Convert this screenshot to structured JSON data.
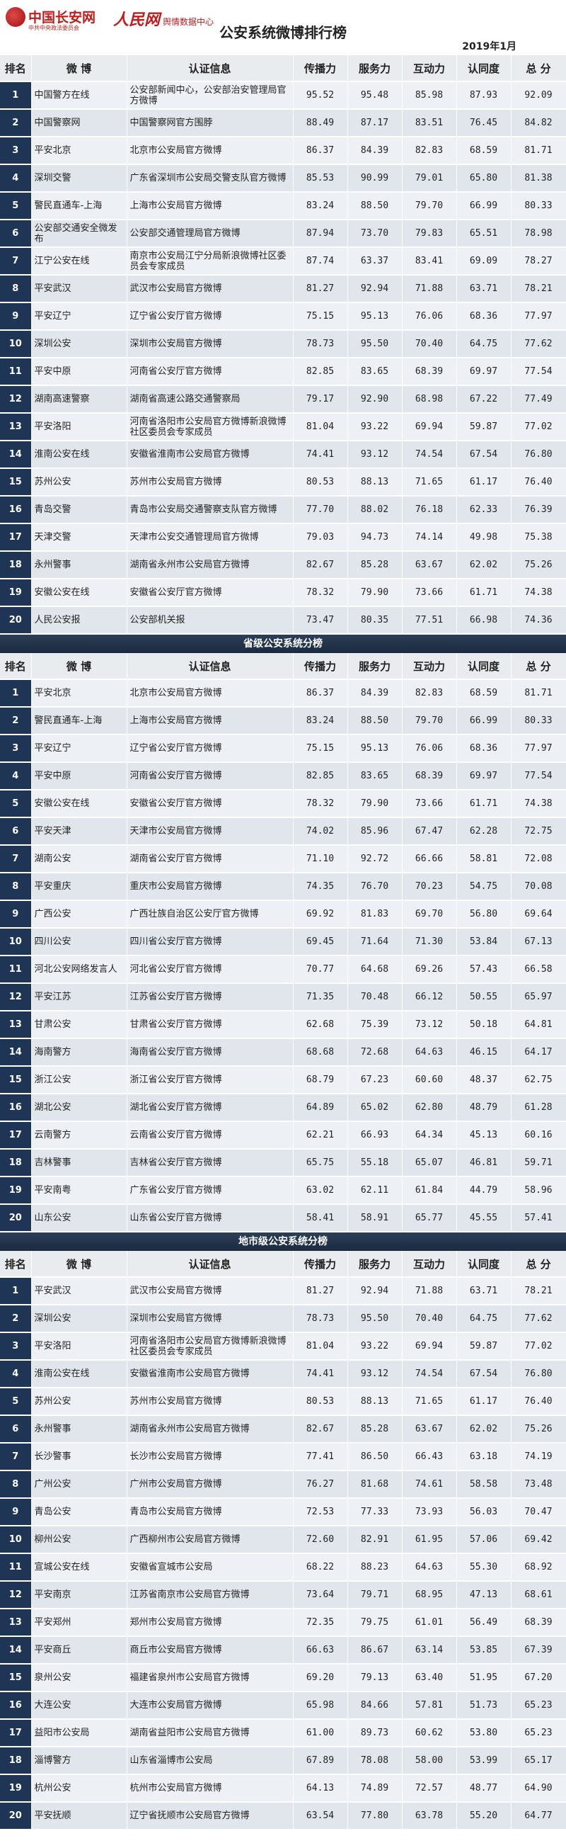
{
  "header": {
    "logo1_title": "中国长安网",
    "logo1_sub": "中共中央政法委员会",
    "logo2_title": "人民网",
    "logo2_sub": "舆情数据中心",
    "title": "公安系统微博排行榜",
    "date": "2019年1月"
  },
  "columns": [
    "排名",
    "微 博",
    "认证信息",
    "传播力",
    "服务力",
    "互动力",
    "认同度",
    "总 分"
  ],
  "sections": [
    {
      "title": "",
      "rows": [
        [
          "1",
          "中国警方在线",
          "公安部新闻中心，公安部治安管理局官方微博",
          "95.52",
          "95.48",
          "85.98",
          "87.93",
          "92.09"
        ],
        [
          "2",
          "中国警察网",
          "中国警察网官方围脖",
          "88.49",
          "87.17",
          "83.51",
          "76.45",
          "84.82"
        ],
        [
          "3",
          "平安北京",
          "北京市公安局官方微博",
          "86.37",
          "84.39",
          "82.83",
          "68.59",
          "81.71"
        ],
        [
          "4",
          "深圳交警",
          "广东省深圳市公安局交警支队官方微博",
          "85.53",
          "90.99",
          "79.01",
          "65.80",
          "81.38"
        ],
        [
          "5",
          "警民直通车-上海",
          "上海市公安局官方微博",
          "83.24",
          "88.50",
          "79.70",
          "66.99",
          "80.33"
        ],
        [
          "6",
          "公安部交通安全微发布",
          "公安部交通管理局官方微博",
          "87.94",
          "73.70",
          "79.83",
          "65.51",
          "78.98"
        ],
        [
          "7",
          "江宁公安在线",
          "南京市公安局江宁分局新浪微博社区委员会专家成员",
          "87.74",
          "63.37",
          "83.41",
          "69.09",
          "78.27"
        ],
        [
          "8",
          "平安武汉",
          "武汉市公安局官方微博",
          "81.27",
          "92.94",
          "71.88",
          "63.71",
          "78.21"
        ],
        [
          "9",
          "平安辽宁",
          "辽宁省公安厅官方微博",
          "75.15",
          "95.13",
          "76.06",
          "68.36",
          "77.97"
        ],
        [
          "10",
          "深圳公安",
          "深圳市公安局官方微博",
          "78.73",
          "95.50",
          "70.40",
          "64.75",
          "77.62"
        ],
        [
          "11",
          "平安中原",
          "河南省公安厅官方微博",
          "82.85",
          "83.65",
          "68.39",
          "69.97",
          "77.54"
        ],
        [
          "12",
          "湖南高速警察",
          "湖南省高速公路交通警察局",
          "79.17",
          "92.90",
          "68.98",
          "67.22",
          "77.49"
        ],
        [
          "13",
          "平安洛阳",
          "河南省洛阳市公安局官方微博新浪微博社区委员会专家成员",
          "81.04",
          "93.22",
          "69.94",
          "59.87",
          "77.02"
        ],
        [
          "14",
          "淮南公安在线",
          "安徽省淮南市公安局官方微博",
          "74.41",
          "93.12",
          "74.54",
          "67.54",
          "76.80"
        ],
        [
          "15",
          "苏州公安",
          "苏州市公安局官方微博",
          "80.53",
          "88.13",
          "71.65",
          "61.17",
          "76.40"
        ],
        [
          "16",
          "青岛交警",
          "青岛市公安局交通警察支队官方微博",
          "77.70",
          "88.02",
          "76.18",
          "62.33",
          "76.39"
        ],
        [
          "17",
          "天津交警",
          "天津市公安交通管理局官方微博",
          "79.03",
          "94.73",
          "74.14",
          "49.98",
          "75.38"
        ],
        [
          "18",
          "永州警事",
          "湖南省永州市公安局官方微博",
          "82.67",
          "85.28",
          "63.67",
          "62.02",
          "75.26"
        ],
        [
          "19",
          "安徽公安在线",
          "安徽省公安厅官方微博",
          "78.32",
          "79.90",
          "73.66",
          "61.71",
          "74.38"
        ],
        [
          "20",
          "人民公安报",
          "公安部机关报",
          "73.47",
          "80.35",
          "77.51",
          "66.98",
          "74.36"
        ]
      ]
    },
    {
      "title": "省级公安系统分榜",
      "rows": [
        [
          "1",
          "平安北京",
          "北京市公安局官方微博",
          "86.37",
          "84.39",
          "82.83",
          "68.59",
          "81.71"
        ],
        [
          "2",
          "警民直通车-上海",
          "上海市公安局官方微博",
          "83.24",
          "88.50",
          "79.70",
          "66.99",
          "80.33"
        ],
        [
          "3",
          "平安辽宁",
          "辽宁省公安厅官方微博",
          "75.15",
          "95.13",
          "76.06",
          "68.36",
          "77.97"
        ],
        [
          "4",
          "平安中原",
          "河南省公安厅官方微博",
          "82.85",
          "83.65",
          "68.39",
          "69.97",
          "77.54"
        ],
        [
          "5",
          "安徽公安在线",
          "安徽省公安厅官方微博",
          "78.32",
          "79.90",
          "73.66",
          "61.71",
          "74.38"
        ],
        [
          "6",
          "平安天津",
          "天津市公安局官方微博",
          "74.02",
          "85.96",
          "67.47",
          "62.28",
          "72.75"
        ],
        [
          "7",
          "湖南公安",
          "湖南省公安厅官方微博",
          "71.10",
          "92.72",
          "66.66",
          "58.81",
          "72.08"
        ],
        [
          "8",
          "平安重庆",
          "重庆市公安局官方微博",
          "74.35",
          "76.70",
          "70.23",
          "54.75",
          "70.08"
        ],
        [
          "9",
          "广西公安",
          "广西壮族自治区公安厅官方微博",
          "69.92",
          "81.83",
          "69.70",
          "56.80",
          "69.64"
        ],
        [
          "10",
          "四川公安",
          "四川省公安厅官方微博",
          "69.45",
          "71.64",
          "71.30",
          "53.84",
          "67.13"
        ],
        [
          "11",
          "河北公安网络发言人",
          "河北省公安厅官方微博",
          "70.77",
          "64.68",
          "69.26",
          "57.43",
          "66.58"
        ],
        [
          "12",
          "平安江苏",
          "江苏省公安厅官方微博",
          "71.35",
          "70.48",
          "66.12",
          "50.55",
          "65.97"
        ],
        [
          "13",
          "甘肃公安",
          "甘肃省公安厅官方微博",
          "62.68",
          "75.39",
          "73.12",
          "50.18",
          "64.81"
        ],
        [
          "14",
          "海南警方",
          "海南省公安厅官方微博",
          "68.68",
          "72.68",
          "64.63",
          "46.15",
          "64.17"
        ],
        [
          "15",
          "浙江公安",
          "浙江省公安厅官方微博",
          "68.79",
          "67.23",
          "60.60",
          "48.37",
          "62.75"
        ],
        [
          "16",
          "湖北公安",
          "湖北省公安厅官方微博",
          "64.89",
          "65.02",
          "62.80",
          "48.79",
          "61.28"
        ],
        [
          "17",
          "云南警方",
          "云南省公安厅官方微博",
          "62.21",
          "66.93",
          "64.34",
          "45.13",
          "60.16"
        ],
        [
          "18",
          "吉林警事",
          "吉林省公安厅官方微博",
          "65.75",
          "55.18",
          "65.07",
          "46.81",
          "59.71"
        ],
        [
          "19",
          "平安南粤",
          "广东省公安厅官方微博",
          "63.02",
          "62.11",
          "61.84",
          "44.79",
          "58.96"
        ],
        [
          "20",
          "山东公安",
          "山东省公安厅官方微博",
          "58.41",
          "58.91",
          "65.77",
          "45.55",
          "57.41"
        ]
      ]
    },
    {
      "title": "地市级公安系统分榜",
      "rows": [
        [
          "1",
          "平安武汉",
          "武汉市公安局官方微博",
          "81.27",
          "92.94",
          "71.88",
          "63.71",
          "78.21"
        ],
        [
          "2",
          "深圳公安",
          "深圳市公安局官方微博",
          "78.73",
          "95.50",
          "70.40",
          "64.75",
          "77.62"
        ],
        [
          "3",
          "平安洛阳",
          "河南省洛阳市公安局官方微博新浪微博社区委员会专家成员",
          "81.04",
          "93.22",
          "69.94",
          "59.87",
          "77.02"
        ],
        [
          "4",
          "淮南公安在线",
          "安徽省淮南市公安局官方微博",
          "74.41",
          "93.12",
          "74.54",
          "67.54",
          "76.80"
        ],
        [
          "5",
          "苏州公安",
          "苏州市公安局官方微博",
          "80.53",
          "88.13",
          "71.65",
          "61.17",
          "76.40"
        ],
        [
          "6",
          "永州警事",
          "湖南省永州市公安局官方微博",
          "82.67",
          "85.28",
          "63.67",
          "62.02",
          "75.26"
        ],
        [
          "7",
          "长沙警事",
          "长沙市公安局官方微博",
          "77.41",
          "86.50",
          "66.43",
          "63.18",
          "74.19"
        ],
        [
          "8",
          "广州公安",
          "广州市公安局官方微博",
          "76.27",
          "81.68",
          "74.61",
          "58.58",
          "73.48"
        ],
        [
          "9",
          "青岛公安",
          "青岛市公安局官方微博",
          "72.53",
          "77.33",
          "73.93",
          "56.03",
          "70.47"
        ],
        [
          "10",
          "柳州公安",
          "广西柳州市公安局官方微博",
          "72.60",
          "82.91",
          "61.95",
          "57.06",
          "69.42"
        ],
        [
          "11",
          "宣城公安在线",
          "安徽省宣城市公安局",
          "68.22",
          "88.23",
          "64.63",
          "55.30",
          "68.92"
        ],
        [
          "12",
          "平安南京",
          "江苏省南京市公安局官方微博",
          "73.64",
          "79.71",
          "68.95",
          "47.13",
          "68.61"
        ],
        [
          "13",
          "平安郑州",
          "郑州市公安局官方微博",
          "72.35",
          "79.75",
          "61.01",
          "56.49",
          "68.39"
        ],
        [
          "14",
          "平安商丘",
          "商丘市公安局官方微博",
          "66.63",
          "86.67",
          "63.14",
          "53.85",
          "67.39"
        ],
        [
          "15",
          "泉州公安",
          "福建省泉州市公安局官方微博",
          "69.20",
          "79.13",
          "63.40",
          "51.95",
          "67.20"
        ],
        [
          "16",
          "大连公安",
          "大连市公安局官方微博",
          "65.98",
          "84.66",
          "57.81",
          "51.73",
          "65.23"
        ],
        [
          "17",
          "益阳市公安局",
          "湖南省益阳市公安局官方微博",
          "61.00",
          "89.73",
          "60.62",
          "53.80",
          "65.23"
        ],
        [
          "18",
          "淄博警方",
          "山东省淄博市公安局",
          "67.89",
          "78.08",
          "58.00",
          "53.99",
          "65.17"
        ],
        [
          "19",
          "杭州公安",
          "杭州市公安局官方微博",
          "64.13",
          "74.89",
          "72.57",
          "48.77",
          "64.90"
        ],
        [
          "20",
          "平安抚顺",
          "辽宁省抚顺市公安局官方微博",
          "63.54",
          "77.80",
          "63.78",
          "55.20",
          "64.77"
        ]
      ]
    }
  ]
}
